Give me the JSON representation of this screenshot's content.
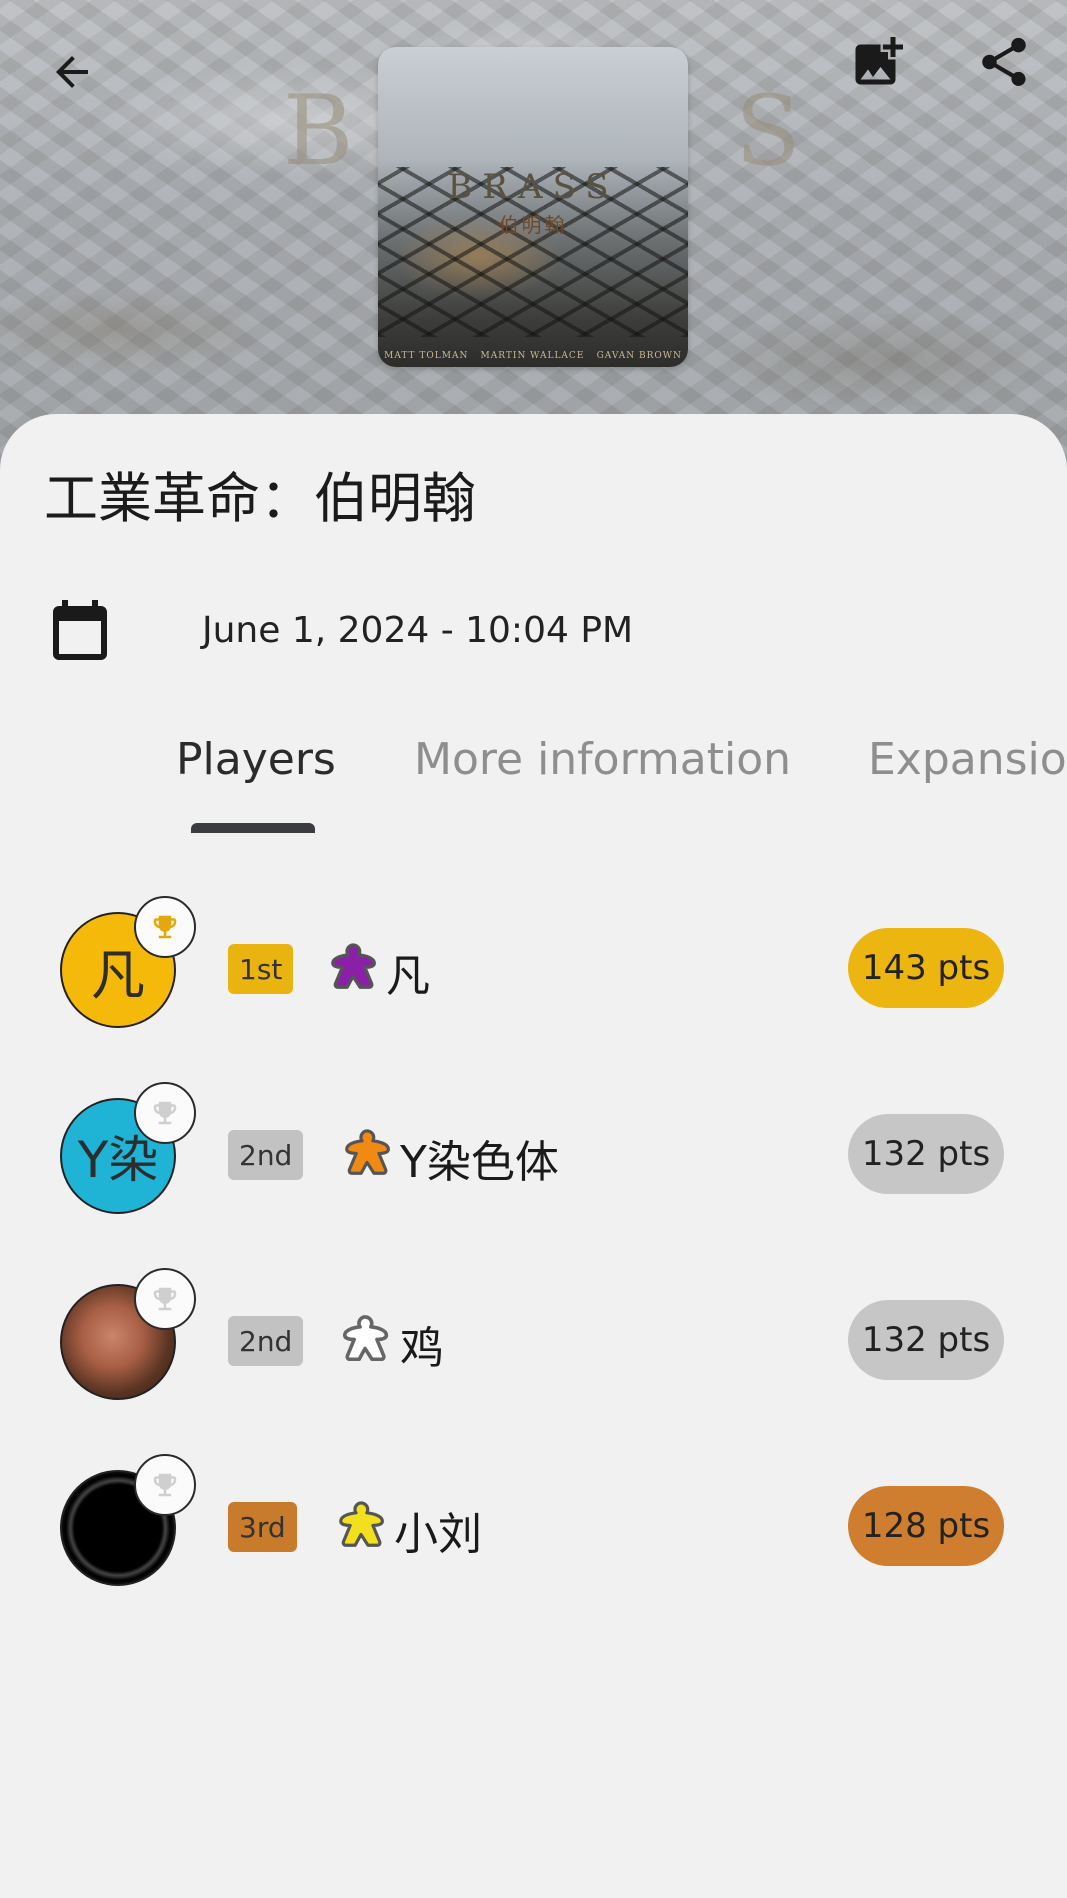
{
  "header": {
    "cover": {
      "title": "BRASS",
      "subtitle": "伯明翰",
      "credits": [
        "MATT TOLMAN",
        "MARTIN WALLACE",
        "GAVAN BROWN"
      ],
      "background_letters": [
        "B",
        "S"
      ]
    },
    "icons": {
      "back": "arrow-left-icon",
      "add_image": "add-photo-icon",
      "share": "share-icon"
    }
  },
  "game": {
    "title": "工業革命：伯明翰",
    "date": "June 1, 2024 - 10:04 PM"
  },
  "tabs": [
    {
      "label": "Players",
      "active": true
    },
    {
      "label": "More information",
      "active": false
    },
    {
      "label": "Expansion",
      "active": false
    }
  ],
  "players": [
    {
      "avatar_text": "凡",
      "avatar_color": "#f5b90a",
      "rank": "1st",
      "rank_color": "#e9b410",
      "meeple_color": "#8b1fa8",
      "name": "凡",
      "score": "143 pts",
      "score_color": "#ecb50f",
      "winner": true
    },
    {
      "avatar_text": "Y染",
      "avatar_color": "#1fb3d6",
      "rank": "2nd",
      "rank_color": "#c2c2c2",
      "meeple_color": "#f08a12",
      "name": "Y染色体",
      "score": "132 pts",
      "score_color": "#c6c6c6",
      "winner": false
    },
    {
      "avatar_text": "",
      "avatar_color": "#5a3a2a",
      "rank": "2nd",
      "rank_color": "#c2c2c2",
      "meeple_color": "#ffffff",
      "name": "鸡",
      "score": "132 pts",
      "score_color": "#c6c6c6",
      "winner": false
    },
    {
      "avatar_text": "",
      "avatar_color": "#000000",
      "rank": "3rd",
      "rank_color": "#c97b2c",
      "meeple_color": "#f2df1e",
      "name": "小刘",
      "score": "128 pts",
      "score_color": "#cf7d2e",
      "winner": false
    }
  ],
  "colors": {
    "background": "#f1f1f1",
    "tab_indicator": "#3a3c3f",
    "trophy_gold": "#e3a80c",
    "trophy_grey": "#cfcfcf"
  }
}
